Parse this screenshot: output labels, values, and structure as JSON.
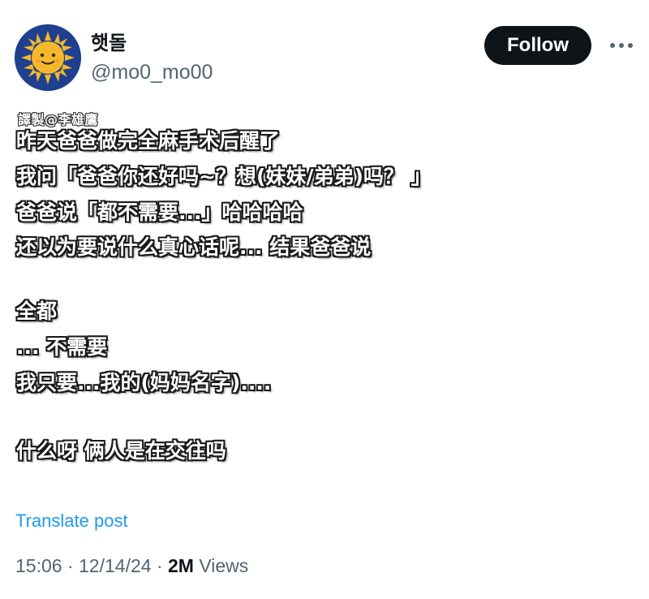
{
  "author": {
    "display_name": "햇돌",
    "handle": "@mo0_mo00"
  },
  "follow_label": "Follow",
  "more_icon": "more-horizontal-icon",
  "content": {
    "credit": "譯製@李雄鷹",
    "lines": [
      "昨天爸爸做完全麻手术后醒了",
      "我问「爸爸你还好吗~？想(妹妹/弟弟)吗？ 」",
      "爸爸说「都不需要...」哈哈哈哈",
      "还以为要说什么真心话呢... 结果爸爸说",
      "全都",
      "... 不需要",
      "我只要...我的(妈妈名字)....",
      "什么呀 俩人是在交往吗"
    ]
  },
  "translate_label": "Translate post",
  "meta": {
    "time": "15:06",
    "separator": "·",
    "date": "12/14/24",
    "views_count": "2M",
    "views_label": "Views"
  },
  "colors": {
    "follow_bg": "#0f1419",
    "link": "#1d9bf0",
    "muted": "#536471",
    "avatar_bg": "#1f3f8f",
    "sun": "#f5b82a"
  }
}
